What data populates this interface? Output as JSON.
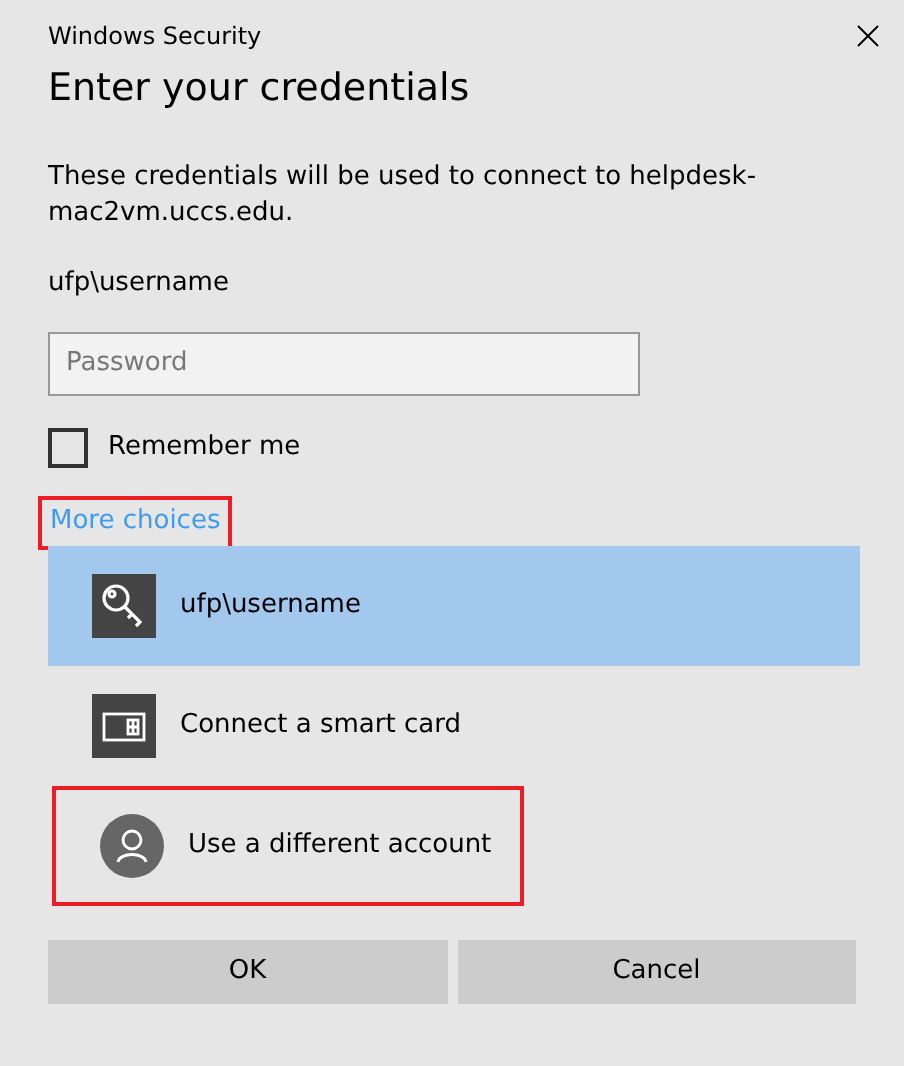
{
  "window": {
    "title": "Windows Security"
  },
  "heading": "Enter your credentials",
  "description": "These credentials will be used to connect to helpdesk-mac2vm.uccs.edu.",
  "username": "ufp\\username",
  "password": {
    "placeholder": "Password"
  },
  "remember": {
    "label": "Remember me",
    "checked": false
  },
  "more_choices": {
    "label": "More choices",
    "highlighted": true
  },
  "options": [
    {
      "kind": "key",
      "label": "ufp\\username",
      "selected": true,
      "highlighted": false
    },
    {
      "kind": "smartcard",
      "label": "Connect a smart card",
      "selected": false,
      "highlighted": false
    },
    {
      "kind": "account",
      "label": "Use a different account",
      "selected": false,
      "highlighted": true
    }
  ],
  "buttons": [
    "OK",
    "Cancel"
  ]
}
